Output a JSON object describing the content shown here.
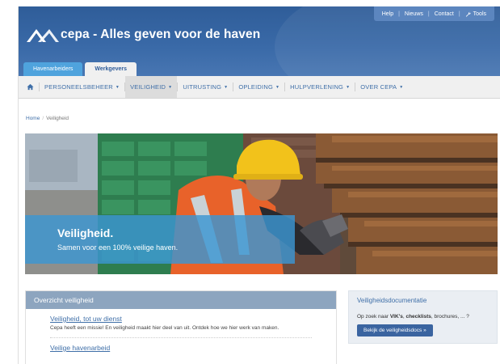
{
  "topbar": {
    "links": [
      "Help",
      "Nieuws",
      "Contact"
    ],
    "tools_label": "Tools"
  },
  "brand": {
    "name": "cepa - Alles geven voor de haven"
  },
  "tabs": [
    {
      "label": "Havenarbeiders"
    },
    {
      "label": "Werkgevers"
    }
  ],
  "nav": {
    "items": [
      {
        "label": "Personeelsbeheer"
      },
      {
        "label": "Veiligheid"
      },
      {
        "label": "Uitrusting"
      },
      {
        "label": "Opleiding"
      },
      {
        "label": "Hulpverlening"
      },
      {
        "label": "Over Cepa"
      }
    ]
  },
  "breadcrumb": {
    "home": "Home",
    "current": "Veiligheid"
  },
  "hero": {
    "title": "Veiligheid.",
    "subtitle": "Samen voor een 100% veilige haven."
  },
  "overview": {
    "heading": "Overzicht veiligheid",
    "items": [
      {
        "title": "Veiligheid, tot uw dienst",
        "desc": "Cepa heeft een missie! En veiligheid maakt hier deel van uit. Ontdek hoe we hier werk van maken."
      },
      {
        "title": "Veilige havenarbeid",
        "desc": ""
      }
    ]
  },
  "docs": {
    "title": "Veiligheidsdocumentatie",
    "text_prefix": "Op zoek naar ",
    "text_bold1": "VIK's",
    "text_comma": ", ",
    "text_bold2": "checklists",
    "text_suffix": ", brochures, ... ?",
    "button": "Bekijk de veiligheidsdocs »"
  },
  "colors": {
    "header": "#2f5d99",
    "accent": "#4fa3dd",
    "link": "#3f6fa8"
  }
}
